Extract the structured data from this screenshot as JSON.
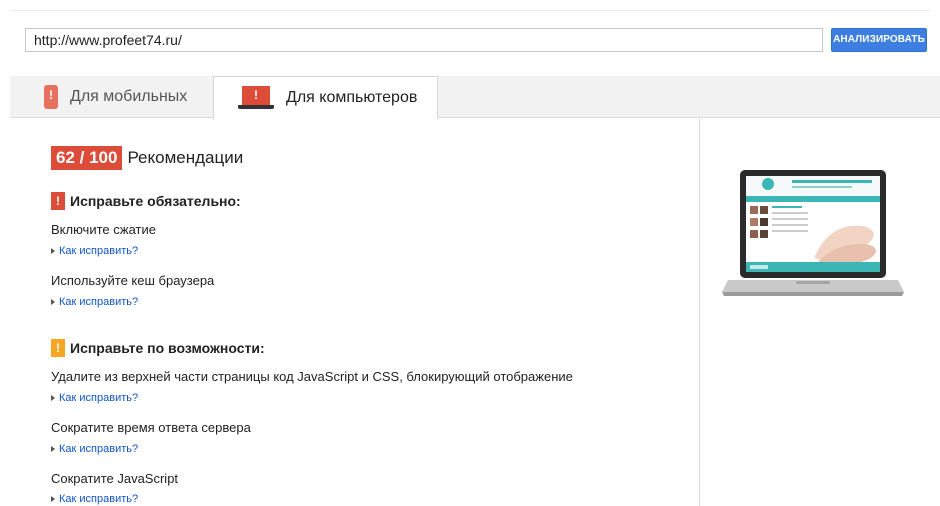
{
  "search": {
    "url_value": "http://www.profeet74.ru/",
    "analyze_label": "АНАЛИЗИРОВАТЬ"
  },
  "tabs": [
    {
      "label": "Для мобильных",
      "icon": "phone-warning-icon"
    },
    {
      "label": "Для компьютеров",
      "icon": "laptop-warning-icon"
    }
  ],
  "score": {
    "value": "62 / 100",
    "label": "Рекомендации",
    "color": "#dd4b39"
  },
  "must_fix": {
    "heading": "Исправьте обязательно:",
    "icon_color": "#dd4b39",
    "items": [
      {
        "title": "Включите сжатие",
        "link": "Как исправить?"
      },
      {
        "title": "Используйте кеш браузера",
        "link": "Как исправить?"
      }
    ]
  },
  "consider_fixing": {
    "heading": "Исправьте по возможности:",
    "icon_color": "#f5a623",
    "items": [
      {
        "title": "Удалите из верхней части страницы код JavaScript и CSS, блокирующий отображение",
        "link": "Как исправить?"
      },
      {
        "title": "Сократите время ответа сервера",
        "link": "Как исправить?"
      },
      {
        "title": "Сократите JavaScript",
        "link": "Как исправить?"
      }
    ]
  },
  "preview": {
    "icon": "laptop-preview-image"
  }
}
